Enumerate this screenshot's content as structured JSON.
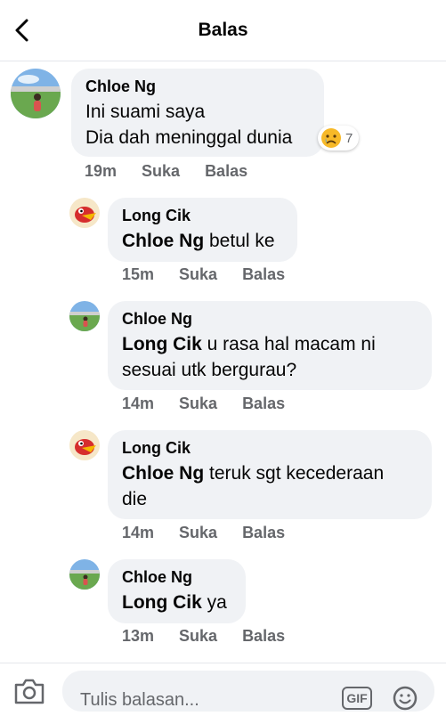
{
  "header": {
    "title": "Balas",
    "back_icon": "back-arrow-icon"
  },
  "comments": [
    {
      "author": "Chloe Ng",
      "lines": [
        "Ini suami saya",
        "Dia dah meninggal dunia"
      ],
      "time": "19m",
      "like": "Suka",
      "reply": "Balas",
      "reaction": {
        "icon": "sad-emoji-icon",
        "count": "7"
      }
    },
    {
      "author": "Long Cik",
      "mention": "Chloe Ng",
      "text": " betul ke",
      "time": "15m",
      "like": "Suka",
      "reply": "Balas"
    },
    {
      "author": "Chloe Ng",
      "mention": "Long Cik",
      "text": " u rasa hal macam ni",
      "text2": "sesuai utk bergurau?",
      "time": "14m",
      "like": "Suka",
      "reply": "Balas"
    },
    {
      "author": "Long Cik",
      "mention": "Chloe Ng",
      "text": " teruk sgt kecederaan",
      "text2": "die",
      "time": "14m",
      "like": "Suka",
      "reply": "Balas"
    },
    {
      "author": "Chloe Ng",
      "mention": "Long Cik",
      "text": " ya",
      "time": "13m",
      "like": "Suka",
      "reply": "Balas"
    }
  ],
  "composer": {
    "placeholder": "Tulis balasan...",
    "gif_label": "GIF",
    "camera_icon": "camera-icon",
    "emoji_icon": "smiley-icon"
  }
}
